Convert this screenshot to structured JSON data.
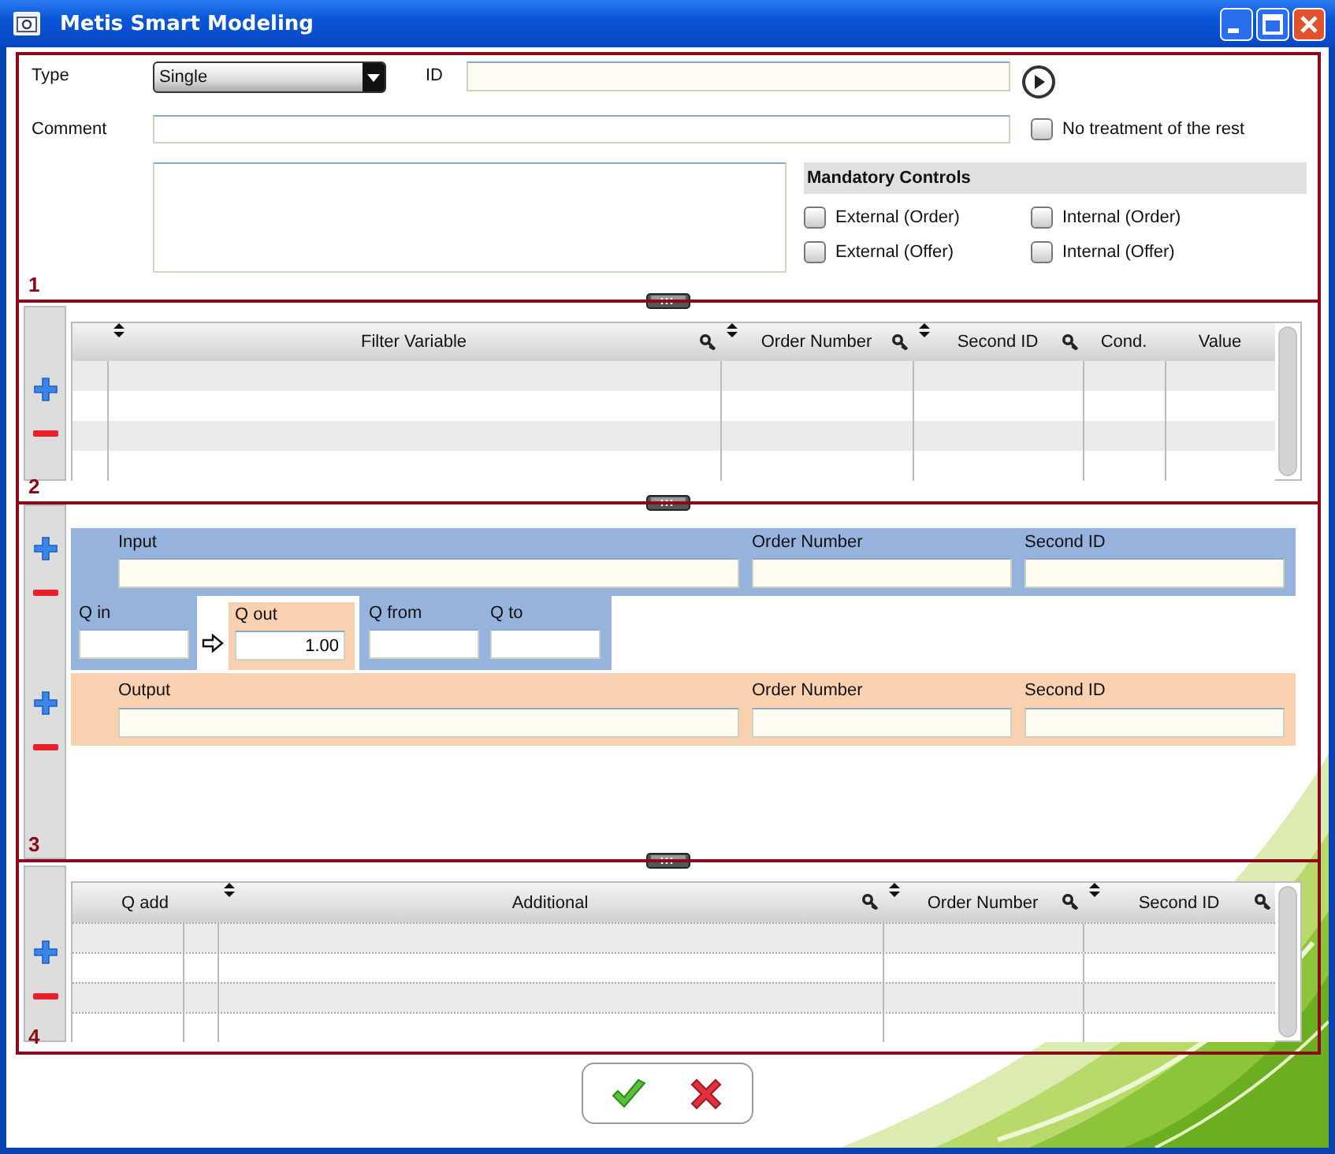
{
  "window": {
    "title": "Metis Smart Modeling"
  },
  "section_1": {
    "number": "1",
    "type": {
      "label": "Type",
      "value": "Single"
    },
    "id": {
      "label": "ID"
    },
    "comment": {
      "label": "Comment"
    },
    "no_treatment": {
      "label": "No treatment of the rest",
      "checked": false
    },
    "mandatory_controls": {
      "title": "Mandatory Controls",
      "options": [
        {
          "label": "External (Order)",
          "checked": false
        },
        {
          "label": "Internal (Order)",
          "checked": false
        },
        {
          "label": "External (Offer)",
          "checked": false
        },
        {
          "label": "Internal (Offer)",
          "checked": false
        }
      ]
    }
  },
  "section_2": {
    "number": "2",
    "columns": [
      {
        "sort_icon": false,
        "key_icon": false
      },
      {
        "label": "Filter Variable",
        "sort_icon": true,
        "key_icon": true
      },
      {
        "label": "Order Number",
        "sort_icon": true,
        "key_icon": true
      },
      {
        "label": "Second ID",
        "sort_icon": true,
        "key_icon": true
      },
      {
        "label": "Cond.",
        "sort_icon": false,
        "key_icon": false
      },
      {
        "label": "Value",
        "sort_icon": false,
        "key_icon": false
      }
    ]
  },
  "section_3": {
    "number": "3",
    "input": {
      "fields": [
        {
          "label": "Input"
        },
        {
          "label": "Order Number"
        },
        {
          "label": "Second ID"
        }
      ]
    },
    "quantities": [
      {
        "label": "Q in",
        "kind": "in"
      },
      {
        "label": "Q out",
        "kind": "out",
        "value": "1.00"
      },
      {
        "label": "Q from",
        "kind": "range"
      },
      {
        "label": "Q to",
        "kind": "range"
      }
    ],
    "output": {
      "fields": [
        {
          "label": "Output"
        },
        {
          "label": "Order Number"
        },
        {
          "label": "Second ID"
        }
      ]
    }
  },
  "section_4": {
    "number": "4",
    "columns": [
      {
        "label": "Q add",
        "sort_icon": false,
        "key_icon": false
      },
      {
        "label": "Additional",
        "sort_icon": true,
        "key_icon": true
      },
      {
        "label": "Order Number",
        "sort_icon": true,
        "key_icon": true
      },
      {
        "label": "Second ID",
        "sort_icon": true,
        "key_icon": true
      }
    ]
  }
}
